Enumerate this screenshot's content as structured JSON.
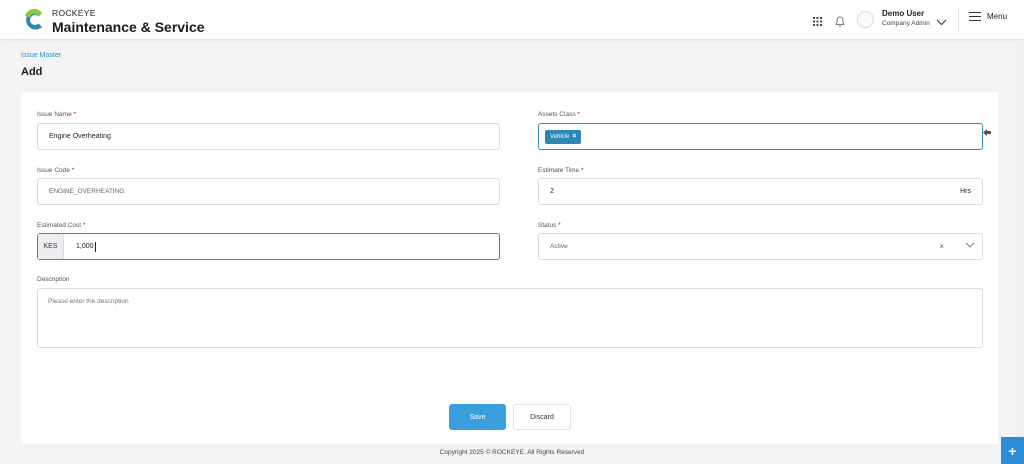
{
  "brand": {
    "small": "ROCKEYE",
    "name": "Maintenance & Service"
  },
  "header": {
    "avatar_text": "··",
    "user_name": "Demo User",
    "user_role": "Company Admin",
    "menu_label": "Menu"
  },
  "breadcrumb": "Issue Master",
  "page_title": "Add",
  "form": {
    "issue_name": {
      "label": "Issue Name",
      "required": "*",
      "value": "Engine Overheating"
    },
    "assets_class": {
      "label": "Assets Class",
      "required": "*",
      "chips": [
        "Vehicle"
      ]
    },
    "issue_code": {
      "label": "Issue Code",
      "required": "*",
      "value": "ENGINE_OVERHEATING"
    },
    "estimate_time": {
      "label": "Estimate Time",
      "required": "*",
      "value": "2",
      "suffix": "Hrs"
    },
    "estimated_cost": {
      "label": "Estimated Cost",
      "required": "*",
      "prefix": "KES",
      "value": "1,000"
    },
    "status": {
      "label": "Status",
      "required": "*",
      "value": "Active",
      "clear": "×"
    },
    "description": {
      "label": "Description",
      "placeholder": "Please enter the description"
    }
  },
  "buttons": {
    "save": "Save",
    "discard": "Discard"
  },
  "footer": "Copyright 2025 © ROCKEYE. All Rights Reserved",
  "fab": "+",
  "colors": {
    "accent": "#3aa0dd",
    "chip": "#2f86b3",
    "link": "#2590d0"
  }
}
